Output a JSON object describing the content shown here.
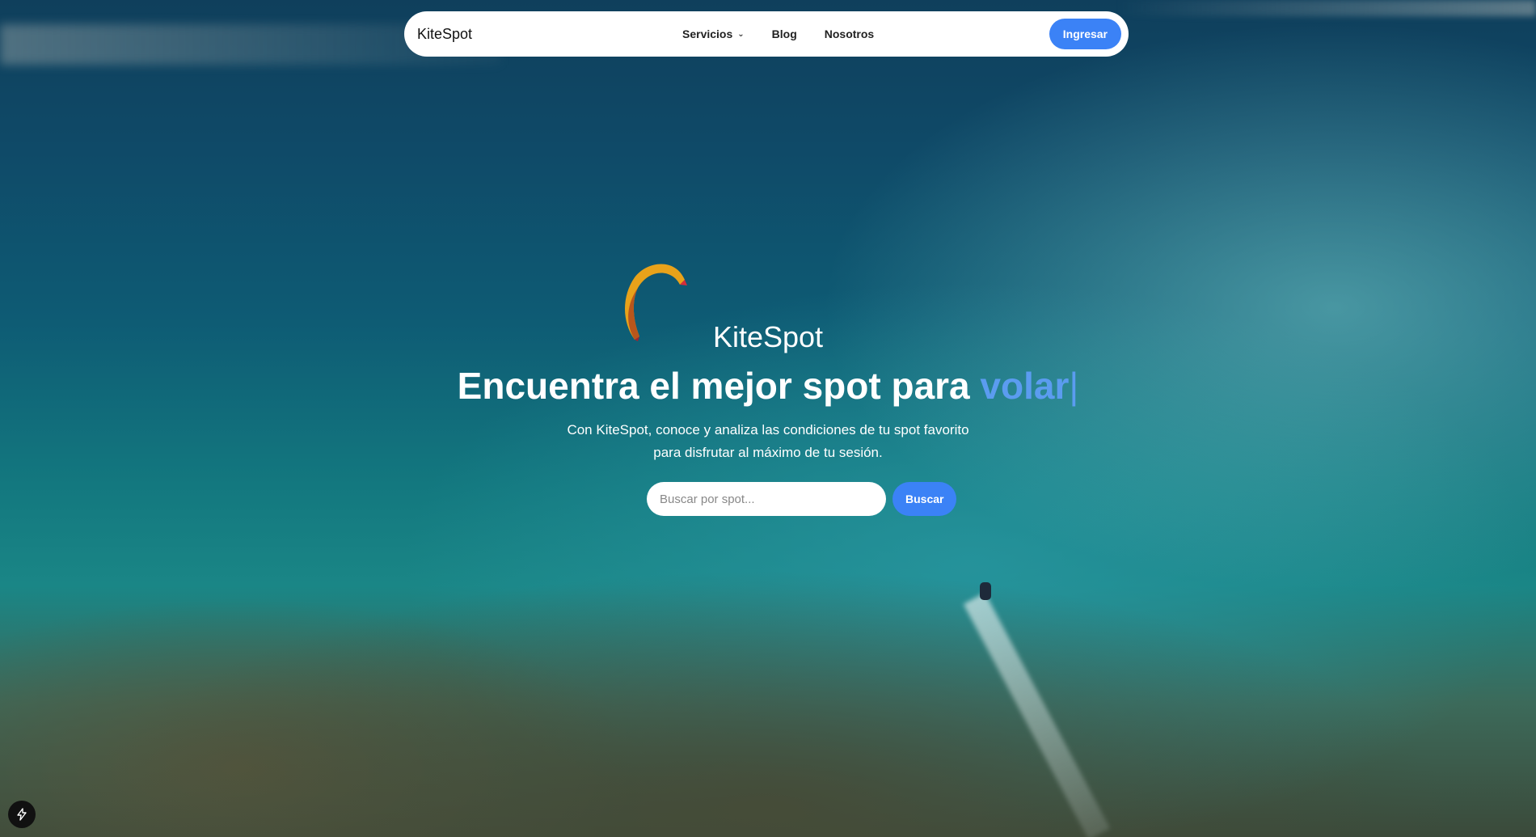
{
  "navbar": {
    "brand": "KiteSpot",
    "links": [
      {
        "label": "Servicios",
        "has_dropdown": true
      },
      {
        "label": "Blog"
      },
      {
        "label": "Nosotros"
      }
    ],
    "login_label": "Ingresar"
  },
  "hero": {
    "brand": "KiteSpot",
    "title_prefix": "Encuentra el mejor spot para ",
    "title_accent": "volar",
    "cursor": "|",
    "subtitle_line1": "Con KiteSpot, conoce y analiza las condiciones de tu spot favorito",
    "subtitle_line2": "para disfrutar al máximo de tu sesión.",
    "accent_color": "#5b9cf0"
  },
  "search": {
    "placeholder": "Buscar por spot...",
    "value": "",
    "button_label": "Buscar"
  },
  "colors": {
    "primary": "#3b82f6",
    "navbar_bg": "#ffffff"
  },
  "icons": {
    "dropdown": "chevron-down-icon",
    "corner_badge": "lightning-bolt-icon"
  }
}
